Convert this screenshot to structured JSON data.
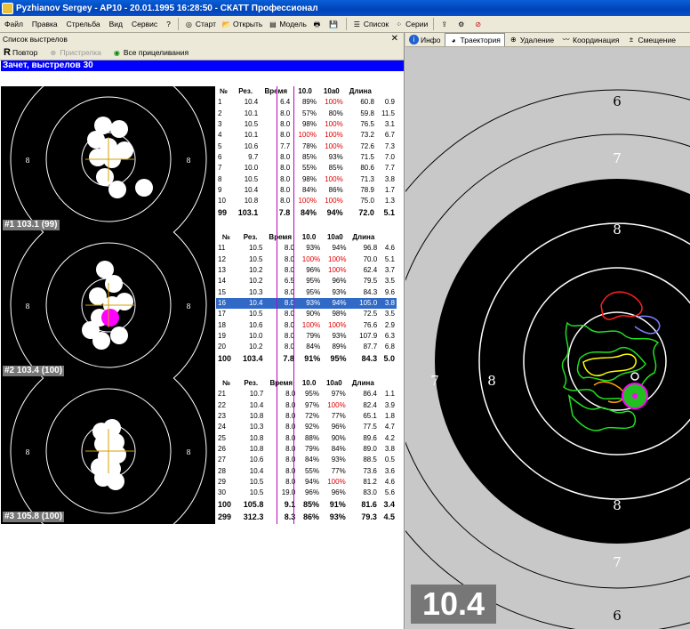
{
  "window": {
    "title": "Pyzhianov Sergey - AP10 - 20.01.1995 16:28:50 - СКАТТ Профессионал"
  },
  "menu": {
    "items": [
      "Файл",
      "Правка",
      "Стрельба",
      "Вид",
      "Сервис",
      "?"
    ],
    "toolbar": {
      "start": "Старт",
      "open": "Открыть",
      "model": "Модель",
      "list": "Список",
      "series": "Серии"
    }
  },
  "left_panel": {
    "title": "Список выстрелов",
    "tools": {
      "repeat": "Повтор",
      "sighting": "Пристрелка",
      "all_aims": "Все прицеливания"
    },
    "session_title": "Зачет, выстрелов 30",
    "columns": [
      "№",
      "Рез.",
      "Время",
      "10.0",
      "10a0",
      "Длина"
    ],
    "ring_label": "8",
    "series": [
      {
        "label": "#1 103.1 (99)",
        "rows": [
          [
            "1",
            "10.4",
            "6.4",
            "89%",
            "100%",
            "60.8",
            "0.9"
          ],
          [
            "2",
            "10.1",
            "8.0",
            "57%",
            "80%",
            "59.8",
            "11.5"
          ],
          [
            "3",
            "10.5",
            "8.0",
            "98%",
            "100%",
            "76.5",
            "3.1"
          ],
          [
            "4",
            "10.1",
            "8.0",
            "100%",
            "100%",
            "73.2",
            "6.7"
          ],
          [
            "5",
            "10.6",
            "7.7",
            "78%",
            "100%",
            "72.6",
            "7.3"
          ],
          [
            "6",
            "9.7",
            "8.0",
            "85%",
            "93%",
            "71.5",
            "7.0"
          ],
          [
            "7",
            "10.0",
            "8.0",
            "55%",
            "85%",
            "80.6",
            "7.7"
          ],
          [
            "8",
            "10.5",
            "8.0",
            "98%",
            "100%",
            "71.3",
            "3.8"
          ],
          [
            "9",
            "10.4",
            "8.0",
            "84%",
            "86%",
            "78.9",
            "1.7"
          ],
          [
            "10",
            "10.8",
            "8.0",
            "100%",
            "100%",
            "75.0",
            "1.3"
          ]
        ],
        "total": [
          "99",
          "103.1",
          "7.8",
          "84%",
          "94%",
          "72.0",
          "5.1"
        ]
      },
      {
        "label": "#2 103.4 (100)",
        "rows": [
          [
            "11",
            "10.5",
            "8.0",
            "93%",
            "94%",
            "96.8",
            "4.6"
          ],
          [
            "12",
            "10.5",
            "8.0",
            "100%",
            "100%",
            "70.0",
            "5.1"
          ],
          [
            "13",
            "10.2",
            "8.0",
            "96%",
            "100%",
            "62.4",
            "3.7"
          ],
          [
            "14",
            "10.2",
            "6.5",
            "95%",
            "96%",
            "79.5",
            "3.5"
          ],
          [
            "15",
            "10.3",
            "8.0",
            "95%",
            "93%",
            "84.3",
            "9.6"
          ],
          [
            "16",
            "10.4",
            "8.0",
            "93%",
            "94%",
            "105.0",
            "3.8"
          ],
          [
            "17",
            "10.5",
            "8.0",
            "90%",
            "98%",
            "72.5",
            "3.5"
          ],
          [
            "18",
            "10.6",
            "8.0",
            "100%",
            "100%",
            "76.6",
            "2.9"
          ],
          [
            "19",
            "10.0",
            "8.0",
            "79%",
            "93%",
            "107.9",
            "6.3"
          ],
          [
            "20",
            "10.2",
            "8.0",
            "84%",
            "89%",
            "87.7",
            "6.8"
          ]
        ],
        "total": [
          "100",
          "103.4",
          "7.8",
          "91%",
          "95%",
          "84.3",
          "5.0"
        ]
      },
      {
        "label": "#3 105.8 (100)",
        "rows": [
          [
            "21",
            "10.7",
            "8.0",
            "95%",
            "97%",
            "86.4",
            "1.1"
          ],
          [
            "22",
            "10.4",
            "8.0",
            "97%",
            "100%",
            "82.4",
            "3.9"
          ],
          [
            "23",
            "10.8",
            "8.0",
            "72%",
            "77%",
            "65.1",
            "1.8"
          ],
          [
            "24",
            "10.3",
            "8.0",
            "92%",
            "96%",
            "77.5",
            "4.7"
          ],
          [
            "25",
            "10.8",
            "8.0",
            "88%",
            "90%",
            "89.6",
            "4.2"
          ],
          [
            "26",
            "10.8",
            "8.0",
            "79%",
            "84%",
            "89.0",
            "3.8"
          ],
          [
            "27",
            "10.6",
            "8.0",
            "84%",
            "93%",
            "88.5",
            "0.5"
          ],
          [
            "28",
            "10.4",
            "8.0",
            "55%",
            "77%",
            "73.6",
            "3.6"
          ],
          [
            "29",
            "10.5",
            "8.0",
            "94%",
            "100%",
            "81.2",
            "4.6"
          ],
          [
            "30",
            "10.5",
            "19.0",
            "96%",
            "96%",
            "83.0",
            "5.6"
          ]
        ],
        "total": [
          "100",
          "105.8",
          "9.1",
          "85%",
          "91%",
          "81.6",
          "3.4"
        ]
      }
    ],
    "grand_total": [
      "299",
      "312.3",
      "8.3",
      "86%",
      "93%",
      "79.3",
      "4.5"
    ],
    "selected_shot": "16"
  },
  "right_panel": {
    "tabs": [
      "Инфо",
      "Траектория",
      "Удаление",
      "Координация",
      "Смещение"
    ],
    "ring_labels": {
      "r6": "6",
      "r7": "7",
      "r8": "8"
    },
    "score": "10.4"
  },
  "colors": {
    "title_bar": "#0a5fd8",
    "session_bar": "#0000ff",
    "selected_row": "#3169c6",
    "percent_highlight": "#e00000",
    "current_shot": "#ff00ff"
  }
}
